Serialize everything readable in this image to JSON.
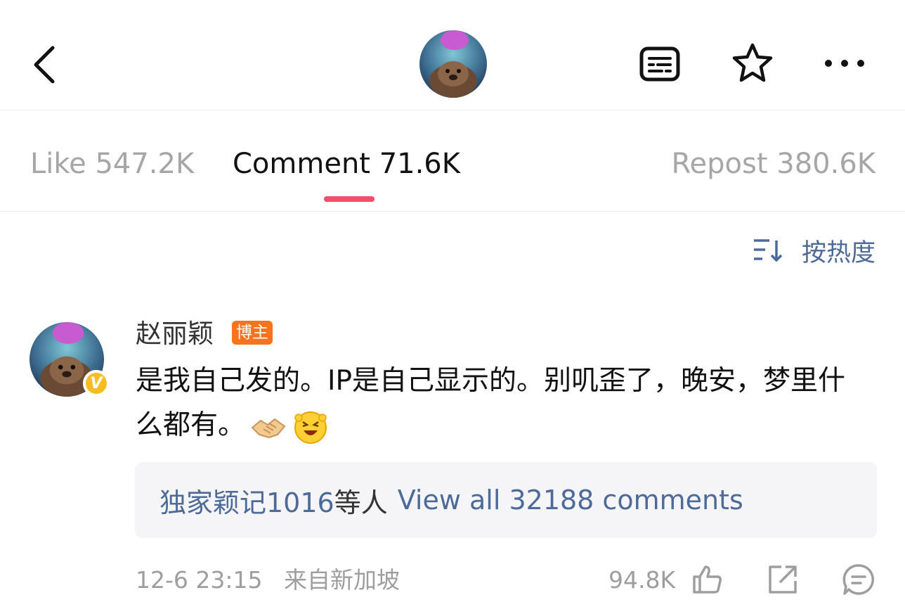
{
  "header": {
    "back_icon": "chevron-left-icon",
    "avatar_desc": "avatar",
    "actions": [
      "list-icon",
      "star-icon",
      "more-icon"
    ]
  },
  "tabs": [
    {
      "label": "Like 547.2K",
      "active": false
    },
    {
      "label": "Comment 71.6K",
      "active": true
    },
    {
      "label": "Repost 380.6K",
      "active": false
    }
  ],
  "sort": {
    "label": "按热度",
    "icon": "sort-icon"
  },
  "comment": {
    "username": "赵丽颖",
    "tag": "博主",
    "text": "是我自己发的。IP是自己显示的。别叽歪了，晚安，梦里什么都有。",
    "emojis": [
      "handshake-emoji",
      "grinning-emoji"
    ],
    "replies": {
      "user": "独家颖记1016",
      "mid": "等人",
      "view_all": "View all 32188 comments"
    },
    "timestamp": "12-6 23:15",
    "location": "来自新加坡",
    "likes": "94.8K"
  },
  "colors": {
    "accent": "#ef5069",
    "link": "#4d6a98",
    "tag": "#f7731e",
    "badge": "#f5bd1f"
  }
}
